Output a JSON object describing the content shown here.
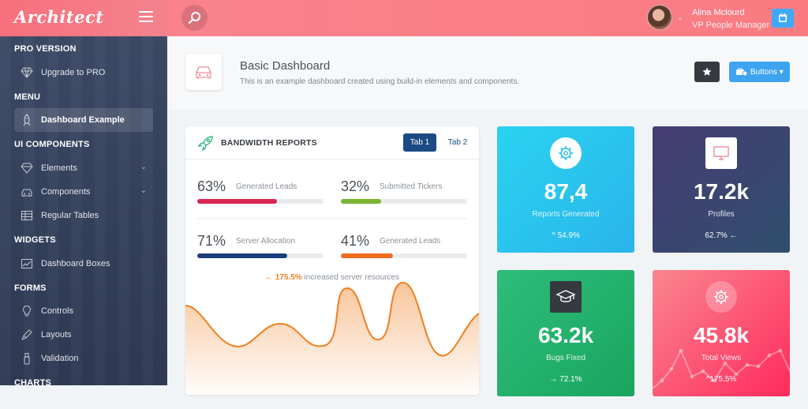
{
  "app": {
    "logo": "Architect"
  },
  "user": {
    "name": "Alina Mclourd",
    "role": "VP People Manager"
  },
  "sidebar": {
    "sections": [
      {
        "head": "PRO VERSION"
      },
      {
        "head": "MENU"
      },
      {
        "head": "UI COMPONENTS"
      },
      {
        "head": "WIDGETS"
      },
      {
        "head": "FORMS"
      },
      {
        "head": "CHARTS"
      }
    ],
    "items": [
      {
        "label": "Upgrade to PRO"
      },
      {
        "label": "Dashboard Example"
      },
      {
        "label": "Elements"
      },
      {
        "label": "Components"
      },
      {
        "label": "Regular Tables"
      },
      {
        "label": "Dashboard Boxes"
      },
      {
        "label": "Controls"
      },
      {
        "label": "Layouts"
      },
      {
        "label": "Validation"
      }
    ]
  },
  "page": {
    "title": "Basic Dashboard",
    "subtitle": "This is an example dashboard created using build-in elements and components.",
    "buttons_label": "Buttons"
  },
  "bandwidth": {
    "title": "BANDWIDTH REPORTS",
    "tabs": [
      "Tab 1",
      "Tab 2"
    ],
    "metrics": [
      {
        "pct": "63%",
        "label": "Generated Leads",
        "value": 0.63,
        "color": "#d92550"
      },
      {
        "pct": "32%",
        "label": "Submitted Tickers",
        "value": 0.32,
        "color": "#7ab532"
      },
      {
        "pct": "71%",
        "label": "Server Allocation",
        "value": 0.71,
        "color": "#1c3f7a"
      },
      {
        "pct": "41%",
        "label": "Generated Leads",
        "value": 0.41,
        "color": "#f06b1f"
      }
    ],
    "note_value": "175.5%",
    "note_text": " increased server resources",
    "note_arrow": "←"
  },
  "stats": [
    {
      "value": "87,4",
      "label": "Reports Generated",
      "change": "54.9%",
      "arrow": "^",
      "icon": "gear-icon"
    },
    {
      "value": "17.2k",
      "label": "Profiles",
      "change": "62.7%",
      "arrow": "←",
      "icon": "monitor-icon"
    },
    {
      "value": "63.2k",
      "label": "Bugs Fixed",
      "change": "72.1%",
      "arrow": "→",
      "icon": "graduation-cap-icon"
    },
    {
      "value": "45.8k",
      "label": "Total Views",
      "change": "175.5%",
      "arrow": "^",
      "icon": "gear-icon"
    }
  ],
  "colors": {
    "topbar": "#f9848f",
    "sidebar": "#34425e",
    "accent": "#3ea4f0",
    "area": "#f07f20"
  }
}
